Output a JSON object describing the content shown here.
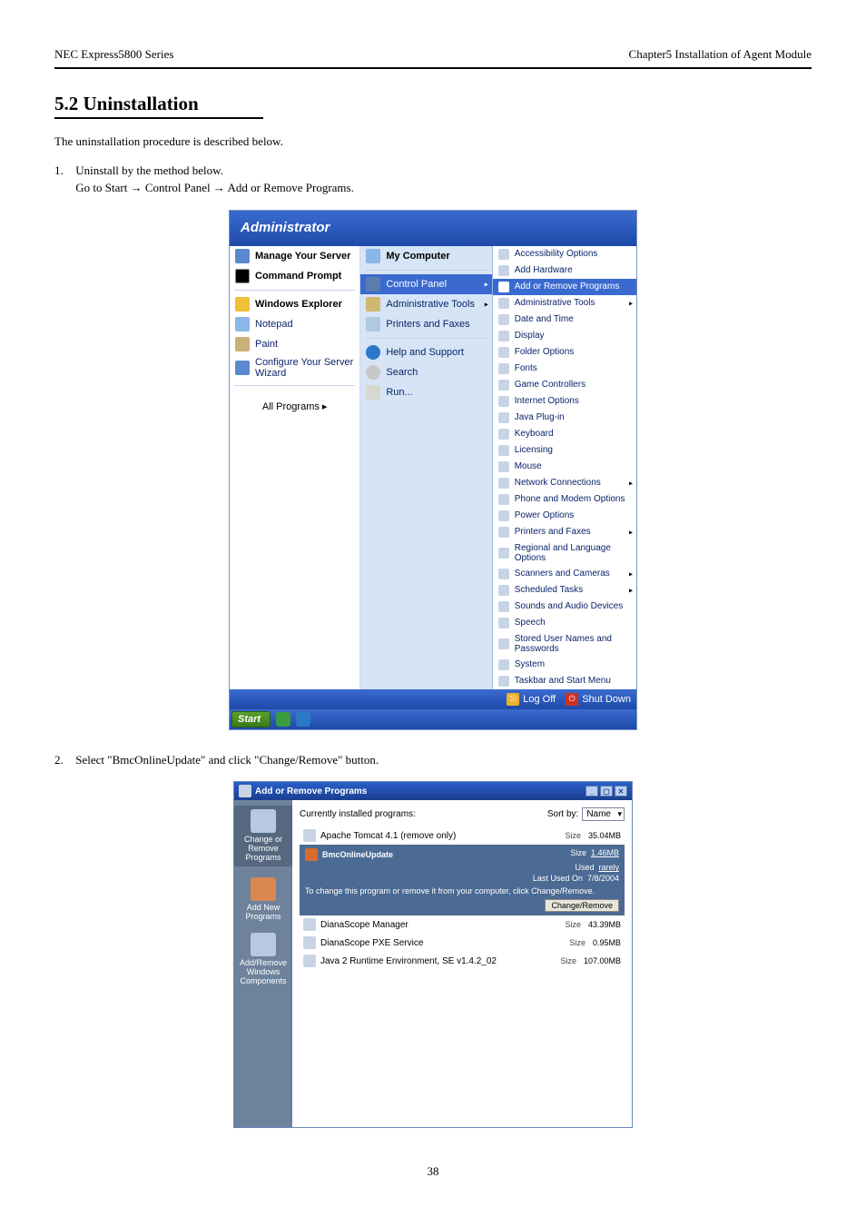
{
  "header": {
    "left": "NEC Express5800 Series",
    "right": "Chapter5 Installation of Agent Module"
  },
  "section": {
    "title": "5.2    Uninstallation",
    "intro_line1": "The uninstallation procedure is described below.",
    "step1_label": "1.",
    "step1_text": "Uninstall by the method below.",
    "step1_path_pre": "Go to Start",
    "step1_path_mid1": "Control Panel",
    "step1_path_mid2": "Add or Remove Programs."
  },
  "startmenu": {
    "header": "Administrator",
    "left": [
      {
        "label": "Manage Your Server",
        "icon": "server",
        "bold": true
      },
      {
        "label": "Command Prompt",
        "icon": "cmd",
        "bold": true
      },
      {
        "label": "Windows Explorer",
        "icon": "explorer",
        "bold": true
      },
      {
        "label": "Notepad",
        "icon": "notepad",
        "bold": false
      },
      {
        "label": "Paint",
        "icon": "paint",
        "bold": false
      },
      {
        "label": "Configure Your Server Wizard",
        "icon": "wizard",
        "bold": false
      }
    ],
    "all_programs": "All Programs  ▸",
    "right": [
      {
        "label": "My Computer",
        "icon": "mycomp",
        "bold": true,
        "arrow": false
      },
      {
        "label": "Control Panel",
        "icon": "cpanel",
        "bold": false,
        "arrow": true,
        "selected": true
      },
      {
        "label": "Administrative Tools",
        "icon": "admin",
        "bold": false,
        "arrow": true
      },
      {
        "label": "Printers and Faxes",
        "icon": "printer",
        "bold": false,
        "arrow": false
      },
      {
        "label": "Help and Support",
        "icon": "help",
        "bold": false,
        "arrow": false
      },
      {
        "label": "Search",
        "icon": "search",
        "bold": false,
        "arrow": false
      },
      {
        "label": "Run...",
        "icon": "run",
        "bold": false,
        "arrow": false
      }
    ],
    "footer": {
      "logoff": "Log Off",
      "shutdown": "Shut Down"
    },
    "taskbar_start": "Start",
    "submenu": [
      {
        "label": "Accessibility Options",
        "arrow": false
      },
      {
        "label": "Add Hardware",
        "arrow": false
      },
      {
        "label": "Add or Remove Programs",
        "arrow": false,
        "selected": true
      },
      {
        "label": "Administrative Tools",
        "arrow": true
      },
      {
        "label": "Date and Time",
        "arrow": false
      },
      {
        "label": "Display",
        "arrow": false
      },
      {
        "label": "Folder Options",
        "arrow": false
      },
      {
        "label": "Fonts",
        "arrow": false
      },
      {
        "label": "Game Controllers",
        "arrow": false
      },
      {
        "label": "Internet Options",
        "arrow": false
      },
      {
        "label": "Java Plug-in",
        "arrow": false
      },
      {
        "label": "Keyboard",
        "arrow": false
      },
      {
        "label": "Licensing",
        "arrow": false
      },
      {
        "label": "Mouse",
        "arrow": false
      },
      {
        "label": "Network Connections",
        "arrow": true
      },
      {
        "label": "Phone and Modem Options",
        "arrow": false
      },
      {
        "label": "Power Options",
        "arrow": false
      },
      {
        "label": "Printers and Faxes",
        "arrow": true
      },
      {
        "label": "Regional and Language Options",
        "arrow": false
      },
      {
        "label": "Scanners and Cameras",
        "arrow": true
      },
      {
        "label": "Scheduled Tasks",
        "arrow": true
      },
      {
        "label": "Sounds and Audio Devices",
        "arrow": false
      },
      {
        "label": "Speech",
        "arrow": false
      },
      {
        "label": "Stored User Names and Passwords",
        "arrow": false
      },
      {
        "label": "System",
        "arrow": false
      },
      {
        "label": "Taskbar and Start Menu",
        "arrow": false
      }
    ]
  },
  "step2_label": "2.",
  "step2_text": "Select \"BmcOnlineUpdate\" and click \"Change/Remove\" button.",
  "arp": {
    "title": "Add or Remove Programs",
    "side": [
      {
        "label": "Change or Remove Programs",
        "name": "change-or-remove-programs",
        "selected": true
      },
      {
        "label": "Add New Programs",
        "name": "add-new-programs"
      },
      {
        "label": "Add/Remove Windows Components",
        "name": "add-remove-windows-components"
      }
    ],
    "top_label": "Currently installed programs:",
    "sort_label": "Sort by:",
    "sort_value": "Name",
    "rows": [
      {
        "name": "Apache Tomcat 4.1 (remove only)",
        "size_label": "Size",
        "size": "35.04MB"
      }
    ],
    "selected": {
      "name": "BmcOnlineUpdate",
      "size_label": "Size",
      "size": "1.46MB",
      "used_label": "Used",
      "used": "rarely",
      "last_label": "Last Used On",
      "last": "7/8/2004",
      "desc": "To change this program or remove it from your computer, click Change/Remove.",
      "btn": "Change/Remove"
    },
    "rows2": [
      {
        "name": "DianaScope Manager",
        "size_label": "Size",
        "size": "43.39MB"
      },
      {
        "name": "DianaScope PXE Service",
        "size_label": "Size",
        "size": "0.95MB"
      },
      {
        "name": "Java 2 Runtime Environment, SE v1.4.2_02",
        "size_label": "Size",
        "size": "107.00MB"
      }
    ]
  },
  "page_number": "38"
}
